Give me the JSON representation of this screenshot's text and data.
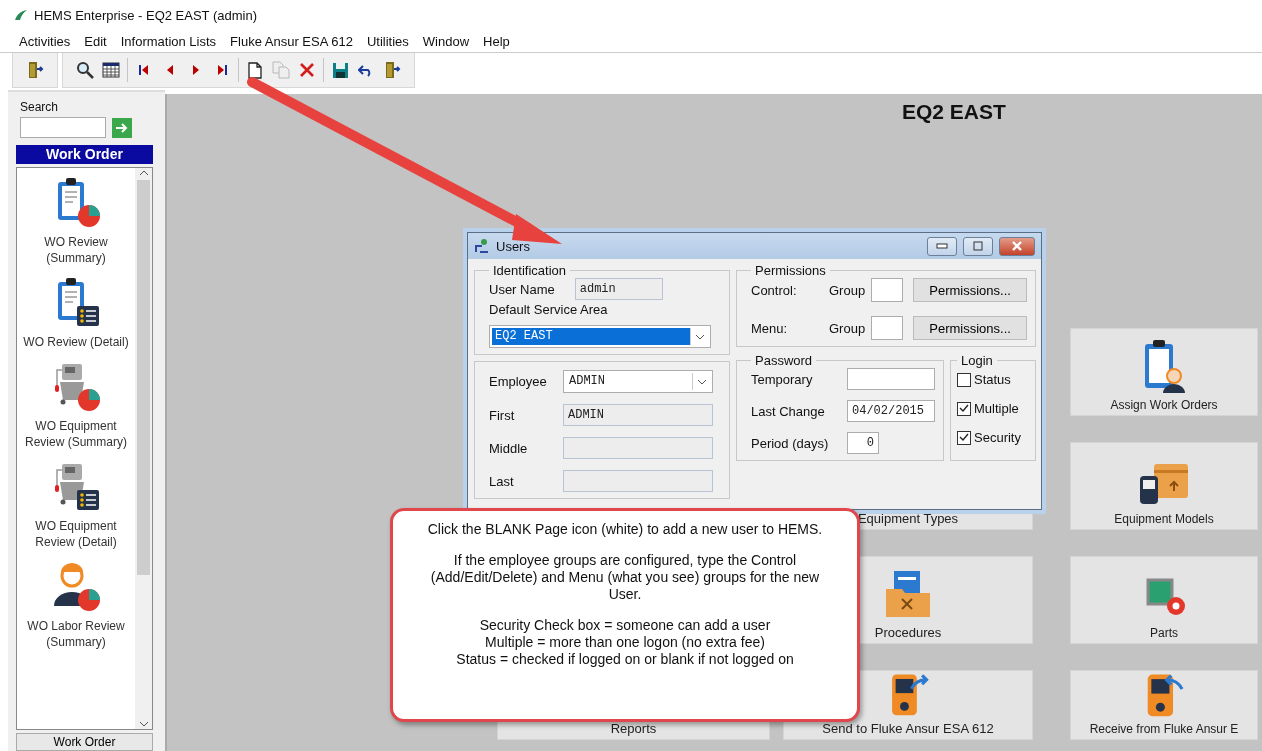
{
  "window": {
    "title": "HEMS Enterprise - EQ2 EAST (admin)"
  },
  "menu": [
    {
      "label": "Activities"
    },
    {
      "label": "Edit"
    },
    {
      "label": "Information Lists"
    },
    {
      "label": "Fluke Ansur ESA 612"
    },
    {
      "label": "Utilities"
    },
    {
      "label": "Window"
    },
    {
      "label": "Help"
    }
  ],
  "toolbar": [
    {
      "buttons": [
        {
          "kind": "exit",
          "disabled": false
        }
      ]
    },
    {
      "buttons": [
        {
          "kind": "search",
          "disabled": false
        },
        {
          "kind": "table",
          "disabled": false
        }
      ]
    },
    {
      "buttons": [
        {
          "kind": "first",
          "disabled": false
        },
        {
          "kind": "prev",
          "disabled": false
        },
        {
          "kind": "next",
          "disabled": false
        },
        {
          "kind": "last",
          "disabled": false
        }
      ]
    },
    {
      "buttons": [
        {
          "kind": "new",
          "disabled": false
        },
        {
          "kind": "copy",
          "disabled": true
        },
        {
          "kind": "delete",
          "disabled": false
        }
      ]
    },
    {
      "buttons": [
        {
          "kind": "save",
          "disabled": false
        },
        {
          "kind": "undo",
          "disabled": false
        },
        {
          "kind": "exit",
          "disabled": false
        }
      ]
    }
  ],
  "sidebar": {
    "search_label": "Search",
    "section_title": "Work Order",
    "items": [
      {
        "label": "WO Review (Summary)",
        "kind": "clipboard-chart"
      },
      {
        "label": "WO Review (Detail)",
        "kind": "clipboard-list"
      },
      {
        "label": "WO Equipment Review (Summary)",
        "kind": "machine-chart"
      },
      {
        "label": "WO Equipment Review (Detail)",
        "kind": "machine-list"
      },
      {
        "label": "WO Labor Review (Summary)",
        "kind": "worker-chart"
      }
    ],
    "footer_button": "Work Order"
  },
  "workspace": {
    "title": "EQ2 EAST",
    "tile_rows": [
      {
        "tiles": [
          {
            "label": "Assign Work Orders",
            "kind": "assign"
          }
        ]
      },
      {
        "tiles": [
          {
            "label": "Equipment Types"
          },
          {
            "label": "Equipment Models",
            "kind": "box"
          }
        ]
      },
      {
        "tiles": [
          {
            "label": "Procedures",
            "kind": "folder"
          },
          {
            "label": "Parts",
            "kind": "chip"
          }
        ]
      },
      {
        "tiles": [
          {
            "label": "Reports"
          },
          {
            "label": "Send to Fluke Ansur ESA 612",
            "kind": "send"
          },
          {
            "label": "Receive from Fluke Ansur E",
            "kind": "receive"
          }
        ]
      }
    ]
  },
  "dialog": {
    "title": "Users",
    "identification": {
      "legend": "Identification",
      "user_name_label": "User Name",
      "user_name": "admin",
      "service_area_label": "Default Service Area",
      "service_area": "EQ2 EAST"
    },
    "employee": {
      "label": "Employee",
      "value": "ADMIN",
      "fields": [
        {
          "label": "First",
          "value": "ADMIN"
        },
        {
          "label": "Middle"
        },
        {
          "label": "Last"
        }
      ]
    },
    "permissions": {
      "legend": "Permissions",
      "rows": [
        {
          "label": "Control:",
          "group_label": "Group",
          "button": "Permissions..."
        },
        {
          "label": "Menu:",
          "group_label": "Group",
          "button": "Permissions..."
        }
      ]
    },
    "password": {
      "legend": "Password",
      "fields": [
        {
          "label": "Temporary",
          "kind": "text"
        },
        {
          "label": "Last Change",
          "value": "04/02/2015",
          "kind": "text"
        },
        {
          "label": "Period (days)",
          "value": "0",
          "kind": "number"
        }
      ]
    },
    "login": {
      "legend": "Login",
      "options": [
        {
          "label": "Status",
          "checked": false
        },
        {
          "label": "Multiple",
          "checked": true
        },
        {
          "label": "Security",
          "checked": true
        }
      ]
    }
  },
  "callout": {
    "paragraphs": [
      {
        "lines": [
          "Click the BLANK Page icon (white) to add a new user to HEMS."
        ]
      },
      {
        "lines": [
          "If the employee groups are configured, type the Control (Add/Edit/Delete) and Menu (what you see) groups for the new User."
        ]
      },
      {
        "lines": [
          "Security Check box = someone can add a user",
          "Multiple = more than one logon (no extra fee)",
          "Status = checked if logged on or blank if not logged on"
        ]
      }
    ]
  }
}
